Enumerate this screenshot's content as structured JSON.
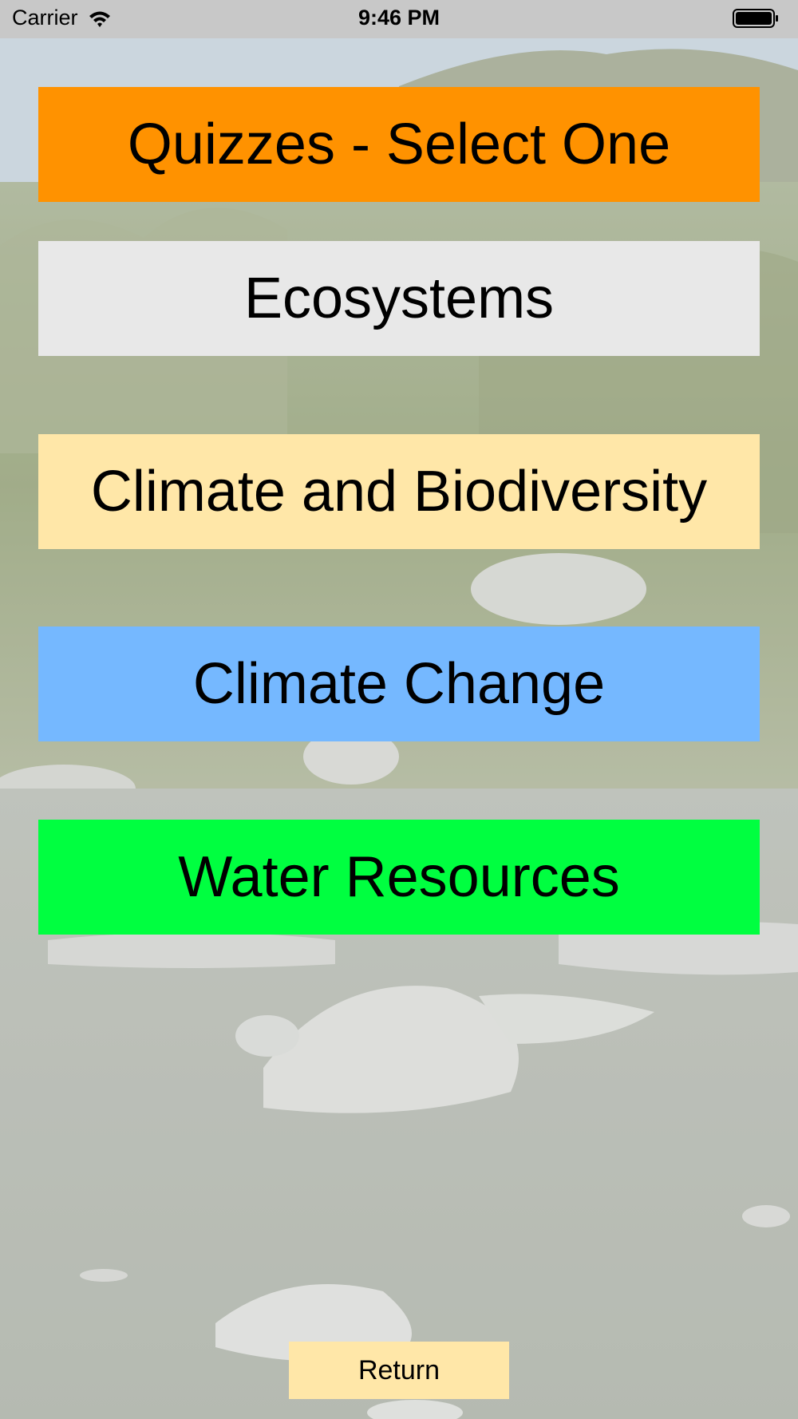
{
  "status_bar": {
    "carrier": "Carrier",
    "time": "9:46 PM",
    "wifi_icon": "wifi-icon",
    "battery_icon": "battery-full-icon"
  },
  "background": {
    "image": "river-landscape-photo",
    "colors": {
      "sky": "#b7c7d2",
      "vegetation": "#7f8f63",
      "water": "#9fa49a",
      "rock": "#c9cbc8"
    }
  },
  "header": {
    "title": "Quizzes - Select One",
    "color": "#ff9200"
  },
  "quizzes": [
    {
      "label": "Ecosystems",
      "color": "#e8e8e8"
    },
    {
      "label": "Climate and Biodiversity",
      "color": "#ffe7a8"
    },
    {
      "label": "Climate Change",
      "color": "#75b8ff"
    },
    {
      "label": "Water Resources",
      "color": "#00ff40"
    }
  ],
  "return_button": {
    "label": "Return",
    "color": "#ffe7a8"
  }
}
